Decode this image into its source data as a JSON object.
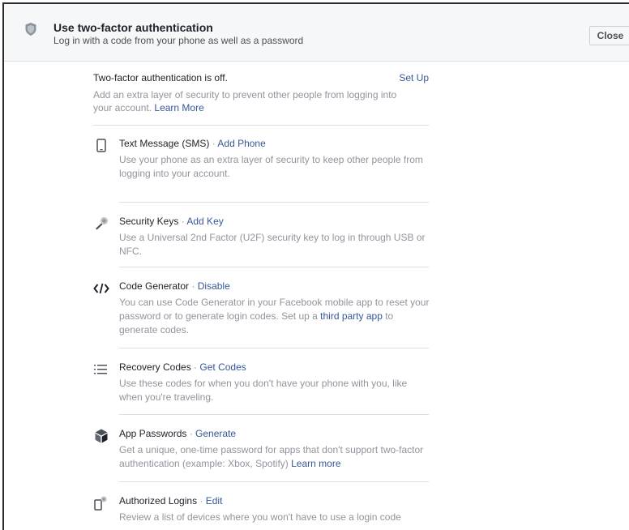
{
  "header": {
    "title": "Use two-factor authentication",
    "subtitle": "Log in with a code from your phone as well as a password",
    "close_label": "Close"
  },
  "status": {
    "title": "Two-factor authentication is off.",
    "setup_label": "Set Up",
    "desc": "Add an extra layer of security to prevent other people from logging into your account.",
    "learn_more": "Learn More"
  },
  "items": [
    {
      "title": "Text Message (SMS)",
      "separator": " · ",
      "action": "Add Phone",
      "desc": "Use your phone as an extra layer of security to keep other people from logging into your account.",
      "icon": "phone-icon"
    },
    {
      "title": "Security Keys",
      "separator": " · ",
      "action": "Add Key",
      "desc": "Use a Universal 2nd Factor (U2F) security key to log in through USB or NFC.",
      "icon": "key-icon"
    },
    {
      "title": "Code Generator",
      "separator": " · ",
      "action": "Disable",
      "desc_part1": "You can use Code Generator in your Facebook mobile app to reset your password or to generate login codes. Set up a ",
      "desc_link": "third party app",
      "desc_part2": " to generate codes.",
      "icon": "code-icon"
    },
    {
      "title": "Recovery Codes",
      "separator": " · ",
      "action": "Get Codes",
      "desc": "Use these codes for when you don't have your phone with you, like when you're traveling.",
      "icon": "list-icon"
    },
    {
      "title": "App Passwords",
      "separator": " · ",
      "action": "Generate",
      "desc_part1": "Get a unique, one-time password for apps that don't support two-factor authentication (example: Xbox, Spotify) ",
      "desc_link": "Learn more",
      "icon": "cube-icon"
    },
    {
      "title": "Authorized Logins",
      "separator": " · ",
      "action": "Edit",
      "desc": "Review a list of devices where you won't have to use a login code",
      "icon": "device-icon"
    }
  ]
}
